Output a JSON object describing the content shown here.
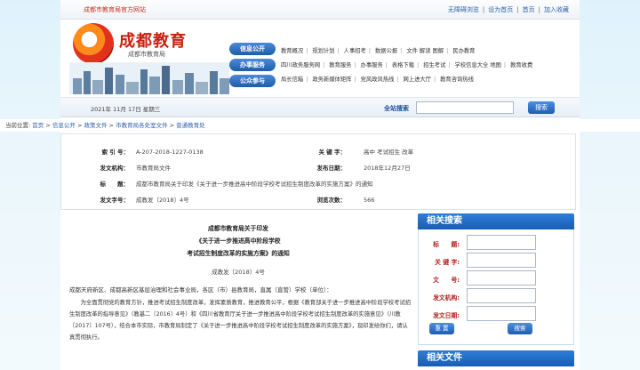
{
  "top": {
    "site_tag": "成都市教育局官方网站",
    "links": [
      "无障碍浏览",
      "设为首页",
      "首页",
      "加入收藏"
    ]
  },
  "logo": {
    "title": "成都教育",
    "subtitle": "成都市教育局"
  },
  "pills": [
    "信息公开",
    "办事服务",
    "公众参与"
  ],
  "nav": {
    "row1": [
      "教育概况",
      "规划计划",
      "人事招考",
      "数据公报",
      "文件",
      "解读",
      "图解",
      "民办教育"
    ],
    "row2": [
      "四川政务服务网",
      "教育服务",
      "办事服务",
      "表格下载",
      "招生考试",
      "学校信息大全",
      "地图",
      "教育收费"
    ],
    "row3": [
      "局长信箱",
      "政务新媒体矩阵",
      "党风政风热线",
      "网上进大厅",
      "教育咨询热线"
    ]
  },
  "datebar": {
    "date": "2021年 11月 17日 星期三",
    "search_label": "全站搜索",
    "search_button": "搜索"
  },
  "breadcrumb": {
    "prefix": "当前位置:",
    "items": [
      "首页",
      "信息公开",
      "政策文件",
      "市教育局各处室文件",
      "普通教育处"
    ]
  },
  "info": {
    "index_label": "索 引 号：",
    "index_value": "A-207-2018-1227-0138",
    "keyword_label": "关 键 字：",
    "keyword_value": "高中 考试招生 改革",
    "issuer_label": "发文机构：",
    "issuer_value": "市教育局文件",
    "date_label": "发布日期：",
    "date_value": "2018年12月27日",
    "title_label": "标　　题：",
    "title_value": "成都市教育局关于印发《关于进一步推进高中阶段学校考试招生制度改革的实施方案》的通知",
    "docno_label": "发文字号：",
    "docno_value": "成教发〔2018〕4号",
    "views_label": "浏览次数：",
    "views_value": "566"
  },
  "article": {
    "title_lines": [
      "成都市教育局关于印发",
      "《关于进一步推进高中阶段学校",
      "考试招生制度改革的实施方案》的通知"
    ],
    "doc_no": "成教发〔2018〕4号",
    "addressee": "成都天府新区、成都高新区基层治理和社会事业局，各区（市）县教育局，直属（直管）学校（单位）：",
    "body": "为全面贯彻党的教育方针，推进考试招生制度改革，发挥素质教育，推进教育公平，根据《教育部关于进一步推进高中阶段学校考试招生制度改革的指导意见》（教基二〔2016〕4号）和《四川省教育厅关于进一步推进高中阶段学校考试招生制度改革的实施意见》（川教〔2017〕107号），结合本市实际，市教育局制定了《关于进一步推进高中阶段学校考试招生制度改革的实施方案》，现印发给你们，请认真贯彻执行。"
  },
  "rpanel": {
    "head": "相关搜索",
    "fields": [
      "标　　题:",
      "关 键 字:",
      "文　　号:",
      "发文机构:",
      "发文日期:"
    ],
    "reset_label": "重 置",
    "search_label": "搜索",
    "head2": "相关文件"
  }
}
